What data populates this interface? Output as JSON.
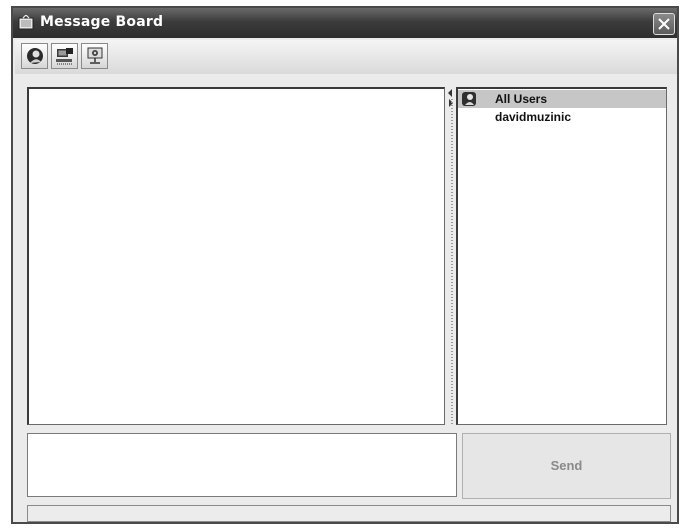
{
  "window": {
    "title": "Message Board"
  },
  "toolbar": {
    "buttons": [
      {
        "icon": "connect-user-icon"
      },
      {
        "icon": "computer-network-icon"
      },
      {
        "icon": "settings-monitor-icon"
      }
    ]
  },
  "users": {
    "items": [
      {
        "label": "All Users",
        "icon": "group-icon",
        "selected": true
      },
      {
        "label": "davidmuzinic",
        "selected": false
      }
    ]
  },
  "compose": {
    "send_label": "Send",
    "send_enabled": false
  },
  "status": {
    "text": ""
  }
}
